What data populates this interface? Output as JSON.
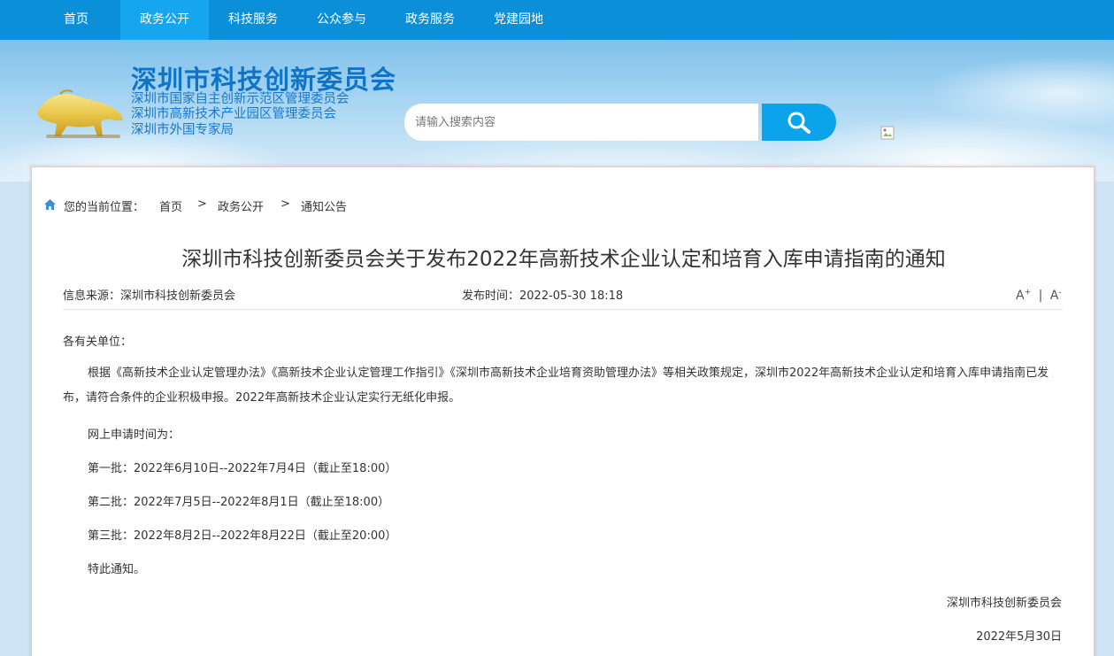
{
  "nav": {
    "items": [
      {
        "label": "首页"
      },
      {
        "label": "政务公开"
      },
      {
        "label": "科技服务"
      },
      {
        "label": "公众参与"
      },
      {
        "label": "政务服务"
      },
      {
        "label": "党建园地"
      }
    ],
    "active_index": 1
  },
  "header": {
    "title": "深圳市科技创新委员会",
    "subtitles": [
      "深圳市国家自主创新示范区管理委员会",
      "深圳市高新技术产业园区管理委员会",
      "深圳市外国专家局"
    ],
    "logo_icon": "golden-bull-icon",
    "search": {
      "placeholder": "请输入搜索内容",
      "icon": "search-icon"
    }
  },
  "breadcrumb": {
    "prefix": "您的当前位置：",
    "items": [
      "首页",
      "政务公开",
      "通知公告"
    ],
    "separator": ">"
  },
  "article": {
    "title": "深圳市科技创新委员会关于发布2022年高新技术企业认定和培育入库申请指南的通知",
    "source": "信息来源：深圳市科技创新委员会",
    "publish_time": "发布时间：2022-05-30 18:18",
    "font_increase": "A",
    "font_decrease": "A",
    "font_increase_mark": "+",
    "font_decrease_mark": "-",
    "font_divider": "|",
    "salutation": "各有关单位：",
    "paragraph": "根据《高新技术企业认定管理办法》《高新技术企业认定管理工作指引》《深圳市高新技术企业培育资助管理办法》等相关政策规定，深圳市2022年高新技术企业认定和培育入库申请指南已发布，请符合条件的企业积极申报。2022年高新技术企业认定实行无纸化申报。",
    "schedule_intro": "网上申请时间为：",
    "batches": [
      "第一批：2022年6月10日--2022年7月4日（截止至18:00）",
      "第二批：2022年7月5日--2022年8月1日（截止至18:00）",
      "第三批：2022年8月2日--2022年8月22日（截止至20:00）"
    ],
    "closing": "特此通知。",
    "signature": "深圳市科技创新委员会",
    "date": "2022年5月30日"
  },
  "colors": {
    "nav_bg": "#0b8fd8",
    "nav_active": "#16a6ef",
    "title_blue": "#0f74c7",
    "search_button": "#0aa3ec"
  }
}
